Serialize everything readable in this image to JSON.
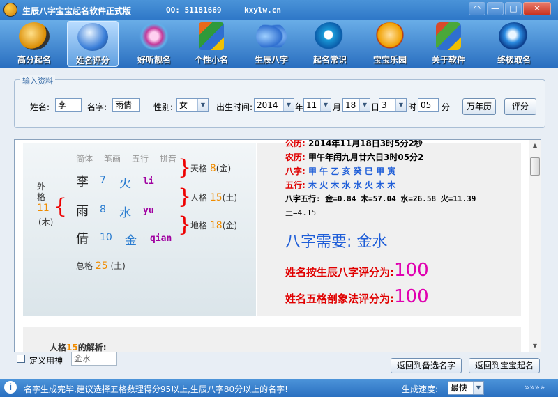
{
  "window": {
    "title": "生辰八字宝宝起名软件正式版",
    "qq": "QQ: 51181669",
    "site": "kxylw.cn",
    "buttons": {
      "feedback": "◠",
      "minimize": "—",
      "maximize": "□",
      "close": "✕"
    }
  },
  "toolbar": [
    {
      "label": "高分起名",
      "icon": "yin-yang-icon",
      "color": "#d98a00"
    },
    {
      "label": "姓名评分",
      "icon": "globe-icon",
      "color": "#3a7ed8"
    },
    {
      "label": "好听靓名",
      "icon": "flower-icon",
      "color": "#c43a9a"
    },
    {
      "label": "个性小名",
      "icon": "office-icon",
      "color": "#e86a1a"
    },
    {
      "label": "生辰八字",
      "icon": "butterfly-icon",
      "color": "#2f6fd0"
    },
    {
      "label": "起名常识",
      "icon": "ie-icon",
      "color": "#1a9ad8"
    },
    {
      "label": "宝宝乐园",
      "icon": "headset-icon",
      "color": "#f0a000"
    },
    {
      "label": "关于软件",
      "icon": "windows-flag-icon",
      "color": "#d84a2a"
    },
    {
      "label": "终极取名",
      "icon": "ie-globe-icon",
      "color": "#2a8ae0"
    }
  ],
  "input": {
    "legend": "输入资料",
    "surname_label": "姓名:",
    "surname": "李",
    "name_label": "名字:",
    "name": "雨倩",
    "gender_label": "性别:",
    "gender": "女",
    "birth_label": "出生时间:",
    "year": "2014",
    "year_unit": "年",
    "month": "11",
    "month_unit": "月",
    "day": "18",
    "day_unit": "日",
    "hour": "3",
    "hour_unit": "时",
    "minute": "05",
    "minute_unit": "分",
    "calendar_btn": "万年历",
    "score_btn": "评分"
  },
  "analysis": {
    "headers": [
      "简体",
      "笔画",
      "五行",
      "拼音"
    ],
    "chars": [
      {
        "char": "李",
        "strokes": "7",
        "element": "火",
        "pinyin": "li"
      },
      {
        "char": "雨",
        "strokes": "8",
        "element": "水",
        "pinyin": "yu"
      },
      {
        "char": "倩",
        "strokes": "10",
        "element": "金",
        "pinyin": "qian"
      }
    ],
    "waige": {
      "label": "外格",
      "value": "11",
      "element": "(木)"
    },
    "tiange": {
      "label": "天格",
      "value": "8",
      "element": "(金)"
    },
    "renge": {
      "label": "人格",
      "value": "15",
      "element": "(土)"
    },
    "dige": {
      "label": "地格",
      "value": "18",
      "element": "(金)"
    },
    "zongge": {
      "label": "总格",
      "value": "25",
      "element": "(土)"
    }
  },
  "bazi": {
    "solar_label": "公历:",
    "solar": "2014年11月18日3时5分2秒",
    "lunar_label": "农历:",
    "lunar": "甲午年闰九月廿六日3时05分2",
    "bazi_label": "八字:",
    "bazi": "甲 午 乙 亥 癸 巳 甲 寅",
    "wuxing_label": "五行:",
    "wuxing": "木 火 木 水 水 火 木 木",
    "scores_line1": "八字五行: 金=0.84 木=57.04 水=26.58 火=11.39",
    "scores_line2": "土=4.15",
    "need": "八字需要: 金水",
    "score1_label": "姓名按生辰八字评分为:",
    "score1": "100",
    "score2_label": "姓名五格剖象法评分为:",
    "score2": "100"
  },
  "detail": {
    "prefix": "人格",
    "value": "15",
    "suffix": "的解析:"
  },
  "footer": {
    "checkbox_label": "定义用神",
    "yongshen_value": "金水",
    "back_candidates": "返回到备选名字",
    "back_home": "返回到宝宝起名"
  },
  "status": {
    "info": "i",
    "message": "名字生成完毕,建议选择五格数理得分95以上,生辰八字80分以上的名字!",
    "speed_label": "生成速度:",
    "speed": "最快",
    "more": "»»»»"
  }
}
